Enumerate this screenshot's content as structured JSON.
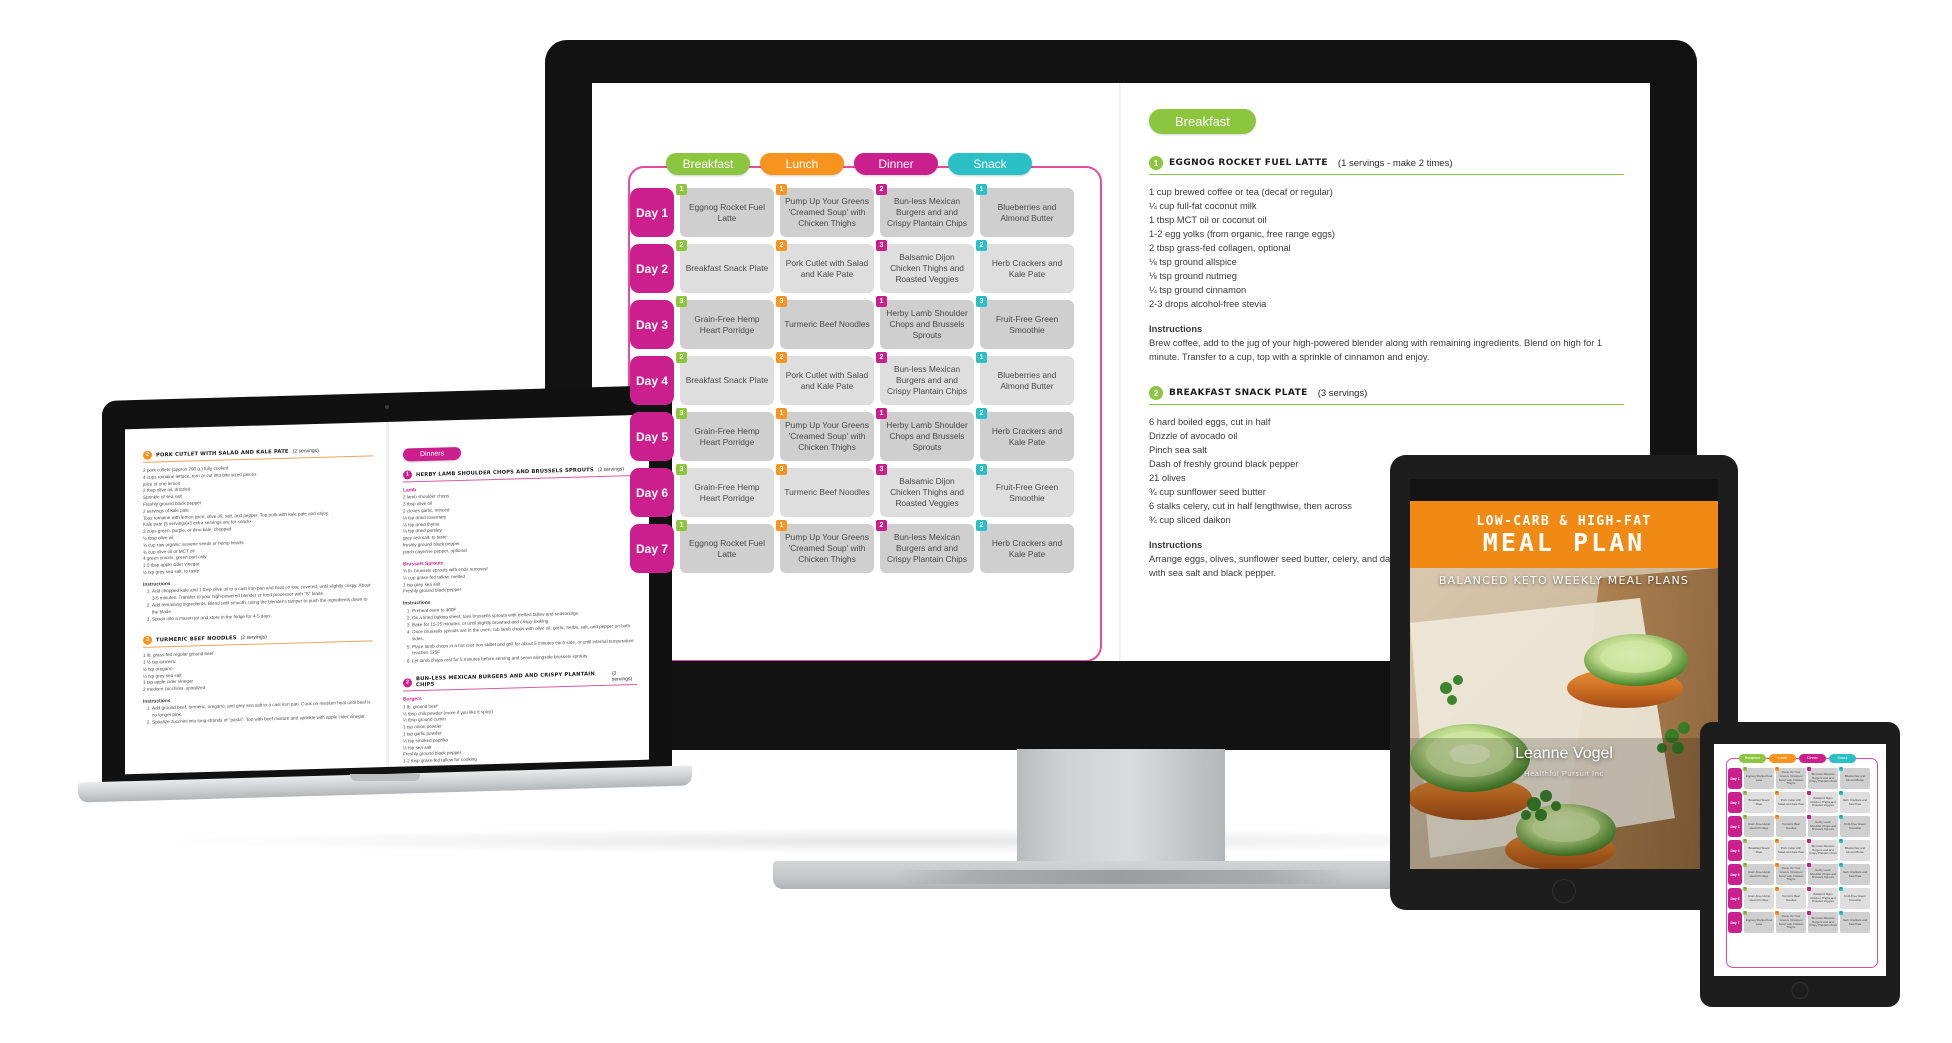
{
  "product": {
    "cover": {
      "kicker": "LOW-CARB & HIGH-FAT",
      "title": "MEAL PLAN",
      "subtitle": "BALANCED KETO WEEKLY MEAL PLANS",
      "author": "Leanne Vogel",
      "brand": "Healthful Pursuit Inc",
      "band_color": "#f18a15"
    }
  },
  "meal_plan": {
    "columns": [
      "Breakfast",
      "Lunch",
      "Dinner",
      "Snack"
    ],
    "column_colors": [
      "#8cc63f",
      "#f7941e",
      "#cc1f8e",
      "#2bbfc6"
    ],
    "day_color": "#cc1f8e",
    "border_color": "#e44d9d",
    "rows": [
      {
        "day": "Day 1",
        "cells": [
          {
            "num": "1",
            "text": "Eggnog Rocket Fuel Latte"
          },
          {
            "num": "1",
            "text": "Pump Up Your Greens 'Creamed Soup' with Chicken Thighs"
          },
          {
            "num": "2",
            "text": "Bun-less Mexican Burgers and and Crispy Plantain Chips"
          },
          {
            "num": "1",
            "text": "Blueberries and Almond Butter"
          }
        ]
      },
      {
        "day": "Day 2",
        "cells": [
          {
            "num": "2",
            "text": "Breakfast Snack Plate"
          },
          {
            "num": "2",
            "text": "Pork Cutlet with Salad and Kale Pate"
          },
          {
            "num": "3",
            "text": "Balsamic Dijon Chicken Thighs and Roasted Veggies"
          },
          {
            "num": "2",
            "text": "Herb Crackers and Kale Pate"
          }
        ]
      },
      {
        "day": "Day 3",
        "cells": [
          {
            "num": "3",
            "text": "Grain-Free Hemp Heart Porridge"
          },
          {
            "num": "3",
            "text": "Turmeric Beef Noodles"
          },
          {
            "num": "1",
            "text": "Herby Lamb Shoulder Chops and Brussels Sprouts"
          },
          {
            "num": "3",
            "text": "Fruit-Free Green Smoothie"
          }
        ]
      },
      {
        "day": "Day 4",
        "cells": [
          {
            "num": "2",
            "text": "Breakfast Snack Plate"
          },
          {
            "num": "2",
            "text": "Pork Cutlet with Salad and Kale Pate"
          },
          {
            "num": "2",
            "text": "Bun-less Mexican Burgers and and Crispy Plantain Chips"
          },
          {
            "num": "1",
            "text": "Blueberries and Almond Butter"
          }
        ]
      },
      {
        "day": "Day 5",
        "cells": [
          {
            "num": "3",
            "text": "Grain-Free Hemp Heart Porridge"
          },
          {
            "num": "1",
            "text": "Pump Up Your Greens 'Creamed Soup' with Chicken Thighs"
          },
          {
            "num": "1",
            "text": "Herby Lamb Shoulder Chops and Brussels Sprouts"
          },
          {
            "num": "2",
            "text": "Herb Crackers and Kale Pate"
          }
        ]
      },
      {
        "day": "Day 6",
        "cells": [
          {
            "num": "3",
            "text": "Grain-Free Hemp Heart Porridge"
          },
          {
            "num": "3",
            "text": "Turmeric Beef Noodles"
          },
          {
            "num": "3",
            "text": "Balsamic Dijon Chicken Thighs and Roasted Veggies"
          },
          {
            "num": "3",
            "text": "Fruit-Free Green Smoothie"
          }
        ]
      },
      {
        "day": "Day 7",
        "cells": [
          {
            "num": "1",
            "text": "Eggnog Rocket Fuel Latte"
          },
          {
            "num": "1",
            "text": "Pump Up Your Greens 'Creamed Soup' with Chicken Thighs"
          },
          {
            "num": "2",
            "text": "Bun-less Mexican Burgers and and Crispy Plantain Chips"
          },
          {
            "num": "2",
            "text": "Herb Crackers and Kale Pate"
          }
        ]
      }
    ]
  },
  "breakfast_page": {
    "section_label": "Breakfast",
    "section_color": "#8cc63f",
    "recipes": [
      {
        "num": "1",
        "title": "EGGNOG ROCKET FUEL LATTE",
        "servings": "(1 servings - make 2 times)",
        "ingredients": [
          "1 cup brewed coffee or tea (decaf or regular)",
          "¼ cup full-fat coconut milk",
          "1 tbsp MCT oil or coconut oil",
          "1-2 egg yolks (from organic, free range eggs)",
          "2 tbsp grass-fed collagen, optional",
          "⅛ tsp ground allspice",
          "⅛ tsp ground nutmeg",
          "¼ tsp ground cinnamon",
          "2-3 drops alcohol-free stevia"
        ],
        "instructions_label": "Instructions",
        "instructions": "Brew coffee, add to the jug of your high-powered blender along with remaining ingredients. Blend on high for 1 minute. Transfer to a cup, top with a sprinkle of cinnamon and enjoy."
      },
      {
        "num": "2",
        "title": "BREAKFAST SNACK PLATE",
        "servings": "(3 servings)",
        "ingredients": [
          "6 hard boiled eggs, cut in half",
          "Drizzle of avocado oil",
          "Pinch sea salt",
          "Dash of freshly ground black pepper",
          "21 olives",
          "¾ cup sunflower seed butter",
          "6 stalks celery, cut in half lengthwise, then across",
          "¾ cup sliced daikon"
        ],
        "instructions_label": "Instructions",
        "instructions": "Arrange eggs, olives, sunflower seed butter, celery, and daikon on a plate. Drizzle eggs with avocado oil, sprinkle with sea salt and black pepper."
      }
    ]
  },
  "lunch_page": {
    "recipes": [
      {
        "num": "2",
        "title": "PORK CUTLET WITH SALAD AND KALE PATE",
        "servings": "(2 servings)",
        "ingredients": [
          "2 pork cutlets (approx 290 g.) fully cooked",
          "4 cups romaine lettuce, torn or cut into bite sized pieces",
          "juice of one lemon",
          "2 tbsp olive oil, drizzled",
          "Sprinkle of sea salt",
          "Freshly ground black pepper",
          "2 servings of kale pate",
          "Toss romaine with lemon juice, olive oil, salt, and pepper. Top pork with kale pate and enjoy.",
          "Kale pate (5 servings)•3 extra servings are for snack•",
          "3 cups green, purple, or dino kale, chopped",
          "½ tbsp olive oil",
          "¾ cup raw organic sesame seeds or hemp hearts",
          "¾ cup olive oil or MCT oil",
          "4 green onions, green part only",
          "1.5 tbsp apple cider vinegar",
          "½ tsp grey sea salt, to taste"
        ],
        "instructions_label": "Instructions",
        "steps": [
          "Add chopped kale and 1 tbsp olive oil to a cast iron pan and heat on low, covered, until slightly crispy. About 3-5 minutes. Transfer to your high-powered blender or food processor with \"S\" blade.",
          "Add remaining ingredients. Blend until smooth, using the blender's tamper to push the ingredients down to the blade.",
          "Spoon into a mason jar and store in the fridge for 4-5 days."
        ]
      },
      {
        "num": "3",
        "title": "TURMERIC BEEF NOODLES",
        "servings": "(2 servings)",
        "ingredients": [
          "1 lb. grass-fed regular ground beef",
          "1 ½ tsp turmeric",
          "½ tsp oregano",
          "¼ tsp grey sea salt",
          "1 tsp apple cider vinegar",
          "2 medium zucchinis, spiralized"
        ],
        "instructions_label": "Instructions",
        "steps": [
          "Add ground beef, turmeric, oregano, and grey sea salt to a cast iron pan. Cook on medium heat until beef is no longer pink.",
          "Spiralize zucchini into long strands of \"pasta\". Top with beef mixture and sprinkle with apple cider vinegar."
        ]
      }
    ]
  },
  "dinners_page": {
    "section_label": "Dinners",
    "section_color": "#cc1f8e",
    "recipes": [
      {
        "num": "1",
        "title": "HERBY LAMB SHOULDER CHOPS AND BRUSSELS SPROUTS",
        "servings": "(2 servings)",
        "groups": [
          {
            "name": "Lamb",
            "items": [
              "2 lamb shoulder chops",
              "3 tbsp olive oil",
              "2 cloves garlic, minced",
              "⅛ tsp dried rosemary",
              "⅛ tsp dried thyme",
              "⅛ tsp dried parsley",
              "grey sea salt, to taste",
              "freshly ground black pepper",
              "pinch cayenne pepper, optional"
            ]
          },
          {
            "name": "Brussels Sprouts",
            "items": [
              "¾ lb. brussels sprouts with ends removed",
              "¼ cup grass-fed tallow, melted",
              "1 tsp grey sea salt",
              "Freshly ground black pepper"
            ]
          }
        ],
        "instructions_label": "Instructions",
        "steps": [
          "Preheat oven to 400F",
          "On a lined baking sheet, toss brussells sprouts with melted tallow and seasonings.",
          "Bake for 15-25 minutes, or until slightly browned and crispy-looking",
          "Once brussells sprouts are in the oven, rub lamb chops with olive oil, garlic, herbs, salt, and pepper on both sides.",
          "Place lamb chops in a hot cast iron skillet and grill for about 5 minutes each side, or until internal temperature reaches 125F",
          "Let lamb chops rest for 5 minutes before serving and serve alongside brussels sprouts"
        ]
      },
      {
        "num": "2",
        "title": "BUN-LESS MEXICAN BURGERS AND AND CRISPY PLANTAIN CHIPS",
        "servings": "(3 servings)",
        "groups": [
          {
            "name": "Burgers",
            "items": [
              "1 lb. ground beef",
              "½ tbsp chili powder (more if you like it spicy)",
              "½ tbsp ground cumin",
              "1 tsp onion powder",
              "1 tsp garlic powder",
              "½ tsp smoked paprika",
              "½ tsp sea salt",
              "Freshly ground black pepper",
              "1-2 tbsp grass-fed tallow for cooking"
            ]
          }
        ]
      }
    ]
  },
  "devices": {
    "desktop": "imac-desktop",
    "laptop": "macbook-laptop",
    "tablet": "ipad-tablet",
    "mini_tablet": "mini-tablet"
  }
}
